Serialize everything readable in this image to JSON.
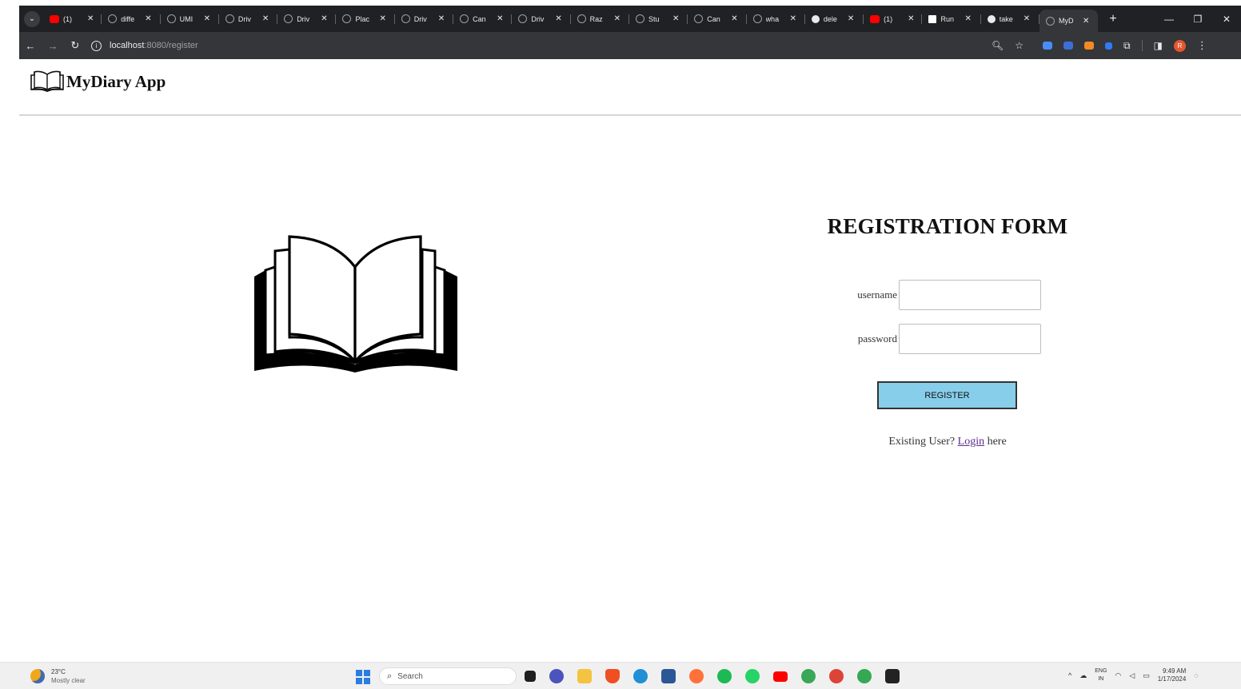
{
  "browser": {
    "tabs": [
      {
        "favicon": "youtube-icon",
        "title": "(1)"
      },
      {
        "favicon": "ai-icon",
        "title": "diffe"
      },
      {
        "favicon": "ai-icon",
        "title": "UMI"
      },
      {
        "favicon": "ai-icon",
        "title": "Driv"
      },
      {
        "favicon": "ai-icon",
        "title": "Driv"
      },
      {
        "favicon": "ai-icon",
        "title": "Plac"
      },
      {
        "favicon": "ai-icon",
        "title": "Driv"
      },
      {
        "favicon": "ai-icon",
        "title": "Can"
      },
      {
        "favicon": "ai-icon",
        "title": "Driv"
      },
      {
        "favicon": "ai-icon",
        "title": "Raz"
      },
      {
        "favicon": "ai-icon",
        "title": "Stu"
      },
      {
        "favicon": "ai-icon",
        "title": "Can"
      },
      {
        "favicon": "ai-icon",
        "title": "wha"
      },
      {
        "favicon": "google-icon",
        "title": "dele"
      },
      {
        "favicon": "youtube-icon",
        "title": "(1)"
      },
      {
        "favicon": "document-icon",
        "title": "Run"
      },
      {
        "favicon": "google-icon",
        "title": "take"
      },
      {
        "favicon": "page-icon",
        "title": "MyD",
        "active": true
      }
    ],
    "new_tab": "+",
    "close_glyph": "✕",
    "url_host": "localhost",
    "url_path": ":8080/register"
  },
  "app": {
    "brand": "MyDiary App"
  },
  "form": {
    "title": "REGISTRATION FORM",
    "username_label": "username",
    "password_label": "password",
    "username_value": "",
    "password_value": "",
    "register_label": "REGISTER",
    "existing_text": "Existing User?",
    "login_link": "Login",
    "here_text": "here"
  },
  "taskbar": {
    "temperature": "23°C",
    "condition": "Mostly clear",
    "search_label": "Search",
    "lang_top": "ENG",
    "lang_bottom": "IN",
    "time": "9:49 AM",
    "date": "1/17/2024"
  },
  "colors": {
    "register_button": "#87ceeb",
    "login_link": "#5b2d8e",
    "chrome_dark": "#202124"
  }
}
